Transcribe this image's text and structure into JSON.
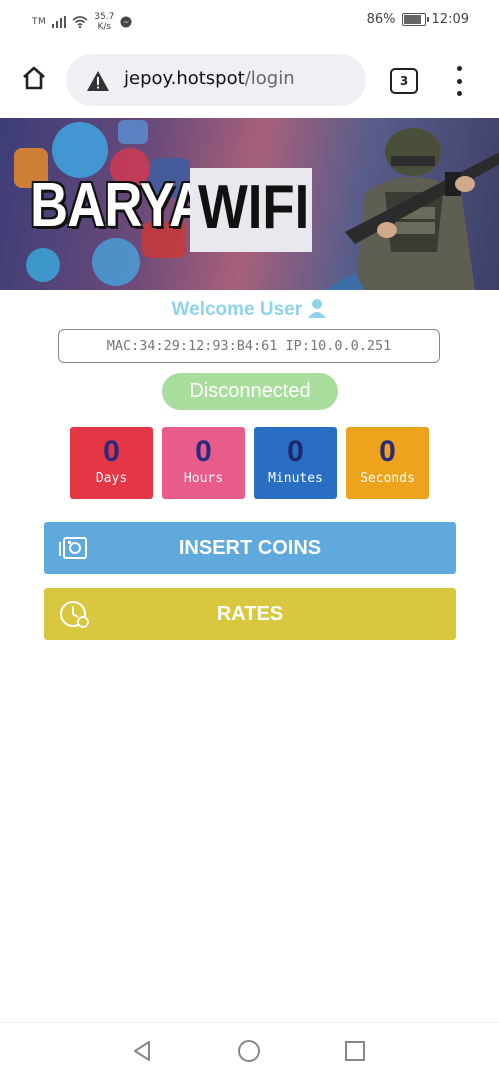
{
  "status_bar": {
    "carrier": "TM",
    "speed_value": "35.7",
    "speed_unit": "K/s",
    "battery": "86%",
    "battery_level": 0.86,
    "time": "12:09"
  },
  "browser": {
    "url_host": "jepoy.hotspot",
    "url_path": "/login",
    "tab_count": "3"
  },
  "banner": {
    "title_left": "BARYA",
    "title_right": "WIFI"
  },
  "welcome_text": "Welcome User",
  "device_info": "MAC:34:29:12:93:B4:61 IP:10.0.0.251",
  "connection_status": "Disconnected",
  "timer": {
    "days": {
      "value": "0",
      "label": "Days"
    },
    "hours": {
      "value": "0",
      "label": "Hours"
    },
    "minutes": {
      "value": "0",
      "label": "Minutes"
    },
    "seconds": {
      "value": "0",
      "label": "Seconds"
    }
  },
  "buttons": {
    "insert_coins": "INSERT COINS",
    "rates": "RATES"
  },
  "colors": {
    "welcome": "#8fd3ec",
    "disconnected": "#a9dd9e",
    "days": "#e53645",
    "hours": "#e85c8c",
    "minutes": "#2a6ec4",
    "seconds": "#eda31c",
    "insert_coins": "#5fa9dd",
    "rates": "#d9c83f"
  },
  "icons": [
    "signal-icon",
    "wifi-icon",
    "messenger-icon",
    "battery-icon",
    "home-icon",
    "warning-icon",
    "tabs-icon",
    "menu-icon",
    "user-icon",
    "coins-icon",
    "clock-icon",
    "back-icon",
    "home-nav-icon",
    "recents-icon"
  ]
}
